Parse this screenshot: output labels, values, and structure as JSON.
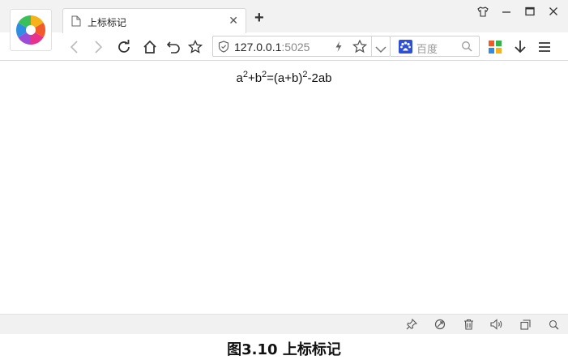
{
  "tab": {
    "title": "上标标记"
  },
  "address": {
    "host": "127.0.0.1",
    "port": ":5025"
  },
  "search": {
    "placeholder": "百度"
  },
  "content": {
    "formula": {
      "t1": "a",
      "s1": "2",
      "t2": "+b",
      "s2": "2",
      "t3": "=(a+b)",
      "s3": "2",
      "t4": "-2ab"
    }
  },
  "caption": "图3.10 上标标记",
  "icons": {
    "logo": "browser-logo",
    "doc": "document-icon",
    "close": "close-icon",
    "new_tab": "plus-icon",
    "shirt": "skin-icon",
    "minimize": "minimize-icon",
    "maximize": "maximize-icon",
    "window_close": "window-close-icon"
  },
  "colors": {
    "accent": "#3b7be6",
    "chrome": "#f2f2f2"
  }
}
